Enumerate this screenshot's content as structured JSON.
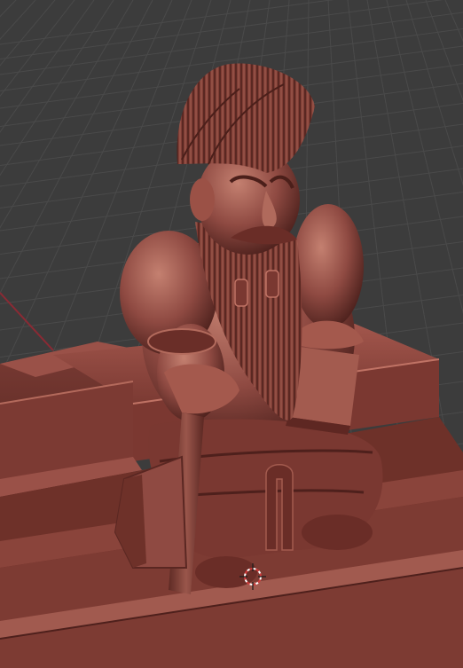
{
  "viewport": {
    "background_color": "#3c3c3c",
    "grid_color": "#4a4a4a",
    "axis_color": "#8a2a34",
    "model_color": "#8c4a43",
    "model_highlight": "#c17a6a",
    "model_shadow": "#4a1e1b",
    "cursor_icon": "3d-cursor-icon"
  }
}
